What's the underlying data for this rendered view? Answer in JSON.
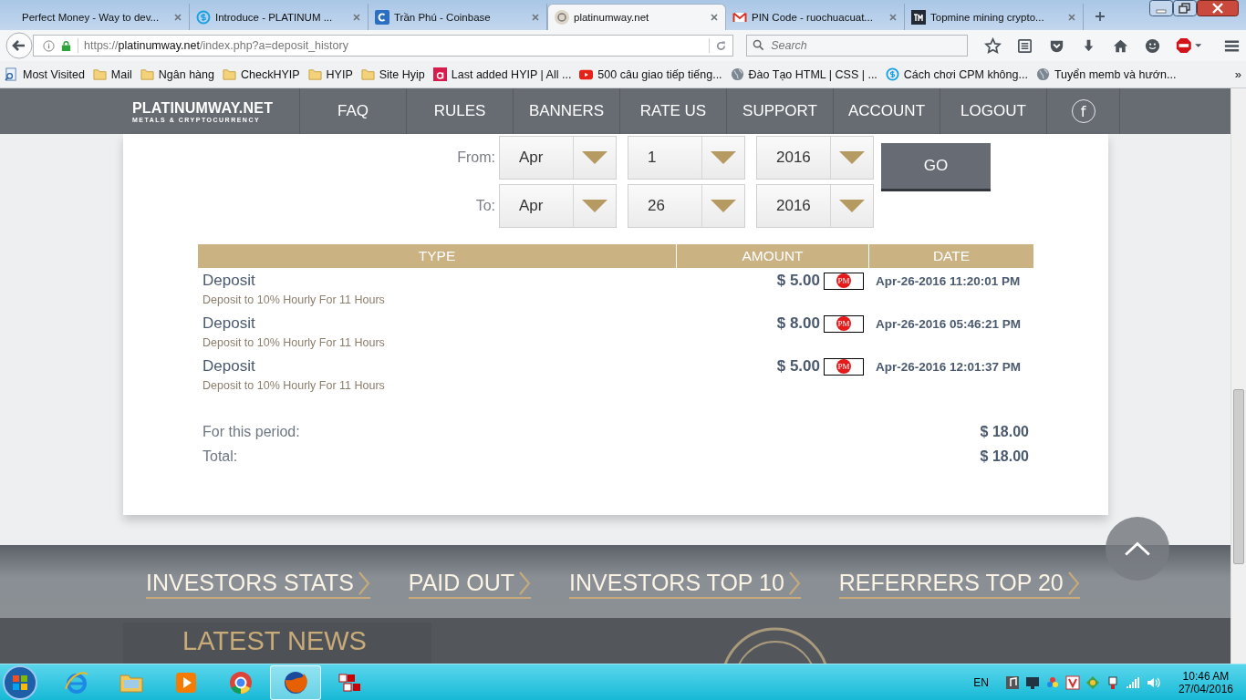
{
  "browser": {
    "tabs": [
      {
        "title": "Perfect Money - Way to dev...",
        "kind": "plain",
        "selected": false
      },
      {
        "title": "Introduce - PLATINUM ...",
        "kind": "coin",
        "selected": false
      },
      {
        "title": "Trần Phú - Coinbase",
        "kind": "letter",
        "selected": false
      },
      {
        "title": "platinumway.net",
        "kind": "site",
        "selected": true
      },
      {
        "title": "PIN Code - ruochuacuat...",
        "kind": "mail",
        "selected": false
      },
      {
        "title": "Topmine mining crypto...",
        "kind": "dark",
        "selected": false
      }
    ],
    "url": {
      "scheme": "https://",
      "host": "platinumway.net",
      "path": "/index.php?a=deposit_history"
    },
    "search": {
      "placeholder": "Search"
    },
    "bookmarks": [
      {
        "label": "Most Visited",
        "kind": "gear"
      },
      {
        "label": "Mail",
        "kind": "folder"
      },
      {
        "label": "Ngân hàng",
        "kind": "folder"
      },
      {
        "label": "CheckHYIP",
        "kind": "folder"
      },
      {
        "label": "HYIP",
        "kind": "folder"
      },
      {
        "label": "Site Hyip",
        "kind": "folder"
      },
      {
        "label": "Last added HYIP | All ...",
        "kind": "site"
      },
      {
        "label": "500 câu giao tiếp tiếng...",
        "kind": "video"
      },
      {
        "label": "Đào Tạo HTML | CSS | ...",
        "kind": "globe"
      },
      {
        "label": "Cách chơi CPM không...",
        "kind": "coin"
      },
      {
        "label": "Tuyển memb và hướn...",
        "kind": "globe"
      }
    ],
    "bookmarks_overflow": "»"
  },
  "site": {
    "logo": "PLATINUMWAY.NET",
    "tagline": "METALS & CRYPTOCURRENCY",
    "nav": [
      "FAQ",
      "RULES",
      "BANNERS",
      "RATE US",
      "SUPPORT",
      "ACCOUNT",
      "LOGOUT"
    ],
    "social_label": "f"
  },
  "filter": {
    "rows": [
      {
        "label": "From:",
        "month": "Apr",
        "day": "1",
        "year": "2016"
      },
      {
        "label": "To:",
        "month": "Apr",
        "day": "26",
        "year": "2016"
      }
    ],
    "button": "GO"
  },
  "table": {
    "columns": [
      "TYPE",
      "AMOUNT",
      "DATE"
    ],
    "rows": [
      {
        "type": "Deposit",
        "description": "Deposit to 10% Hourly For 11 Hours",
        "amount": "$ 5.00",
        "badge": "PM",
        "date": "Apr-26-2016 11:20:01 PM"
      },
      {
        "type": "Deposit",
        "description": "Deposit to 10% Hourly For 11 Hours",
        "amount": "$ 8.00",
        "badge": "PM",
        "date": "Apr-26-2016 05:46:21 PM"
      },
      {
        "type": "Deposit",
        "description": "Deposit to 10% Hourly For 11 Hours",
        "amount": "$ 5.00",
        "badge": "PM",
        "date": "Apr-26-2016 12:01:37 PM"
      }
    ]
  },
  "summary": [
    {
      "label": "For this period:",
      "value": "$ 18.00"
    },
    {
      "label": "Total:",
      "value": "$ 18.00"
    }
  ],
  "footer_links": [
    "INVESTORS STATS",
    "PAID OUT",
    "INVESTORS TOP 10",
    "REFERRERS TOP 20"
  ],
  "news_title": "LATEST NEWS",
  "taskbar": {
    "apps": [
      {
        "kind": "ie",
        "selected": false
      },
      {
        "kind": "explorer",
        "selected": false
      },
      {
        "kind": "media",
        "selected": false
      },
      {
        "kind": "chrome",
        "selected": false
      },
      {
        "kind": "firefox",
        "selected": true
      },
      {
        "kind": "unikey",
        "selected": false
      }
    ],
    "language": "EN",
    "time": "10:46 AM",
    "date": "27/04/2016"
  }
}
